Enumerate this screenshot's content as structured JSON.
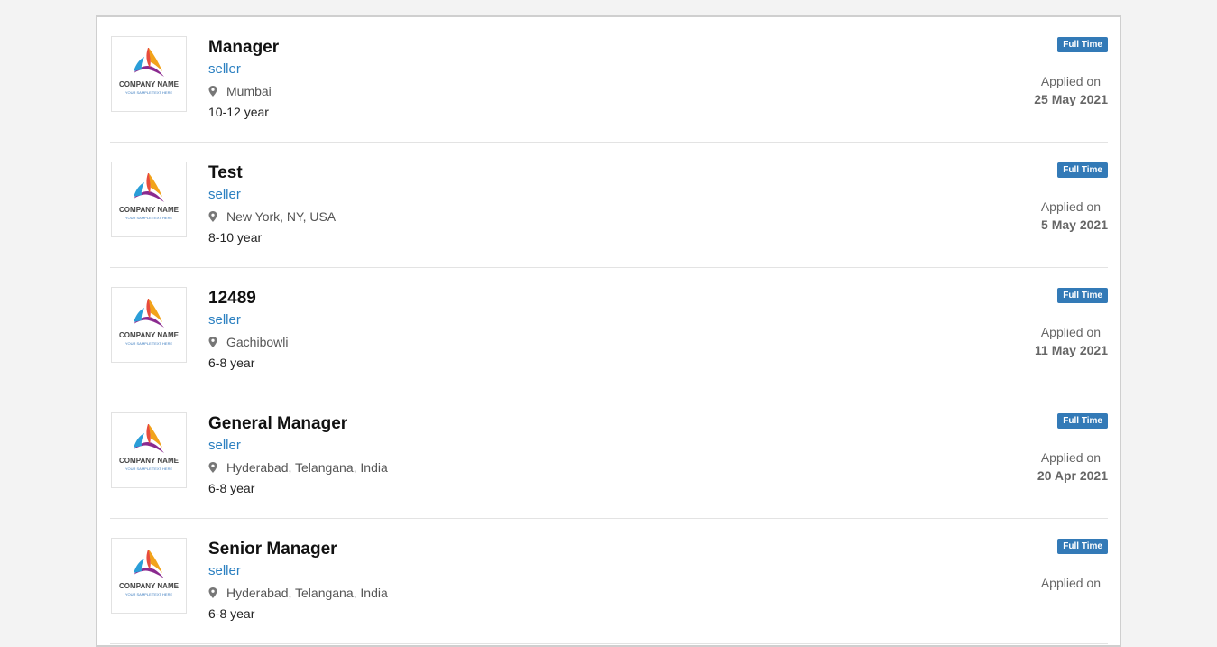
{
  "colors": {
    "badge": "#337ab7",
    "company_link": "#2a7fc0"
  },
  "icons": {
    "location": "map-pin-icon",
    "logo": "company-logo"
  },
  "jobs": [
    {
      "title": "Manager",
      "company": "seller",
      "location": "Mumbai",
      "experience": "10-12 year",
      "type": "Full Time",
      "applied_label": "Applied on",
      "applied_date": "25 May 2021",
      "logo_name": "COMPANY NAME",
      "logo_tagline": "YOUR SAMPLE TEXT HERE"
    },
    {
      "title": "Test",
      "company": "seller",
      "location": "New York, NY, USA",
      "experience": "8-10 year",
      "type": "Full Time",
      "applied_label": "Applied on",
      "applied_date": "5 May 2021",
      "logo_name": "COMPANY NAME",
      "logo_tagline": "YOUR SAMPLE TEXT HERE"
    },
    {
      "title": "12489",
      "company": "seller",
      "location": "Gachibowli",
      "experience": "6-8 year",
      "type": "Full Time",
      "applied_label": "Applied on",
      "applied_date": "11 May 2021",
      "logo_name": "COMPANY NAME",
      "logo_tagline": "YOUR SAMPLE TEXT HERE"
    },
    {
      "title": "General Manager",
      "company": "seller",
      "location": "Hyderabad, Telangana, India",
      "experience": "6-8 year",
      "type": "Full Time",
      "applied_label": "Applied on",
      "applied_date": "20 Apr 2021",
      "logo_name": "COMPANY NAME",
      "logo_tagline": "YOUR SAMPLE TEXT HERE"
    },
    {
      "title": "Senior Manager",
      "company": "seller",
      "location": "Hyderabad, Telangana, India",
      "experience": "6-8 year",
      "type": "Full Time",
      "applied_label": "Applied on",
      "applied_date": "",
      "logo_name": "COMPANY NAME",
      "logo_tagline": "YOUR SAMPLE TEXT HERE"
    }
  ]
}
